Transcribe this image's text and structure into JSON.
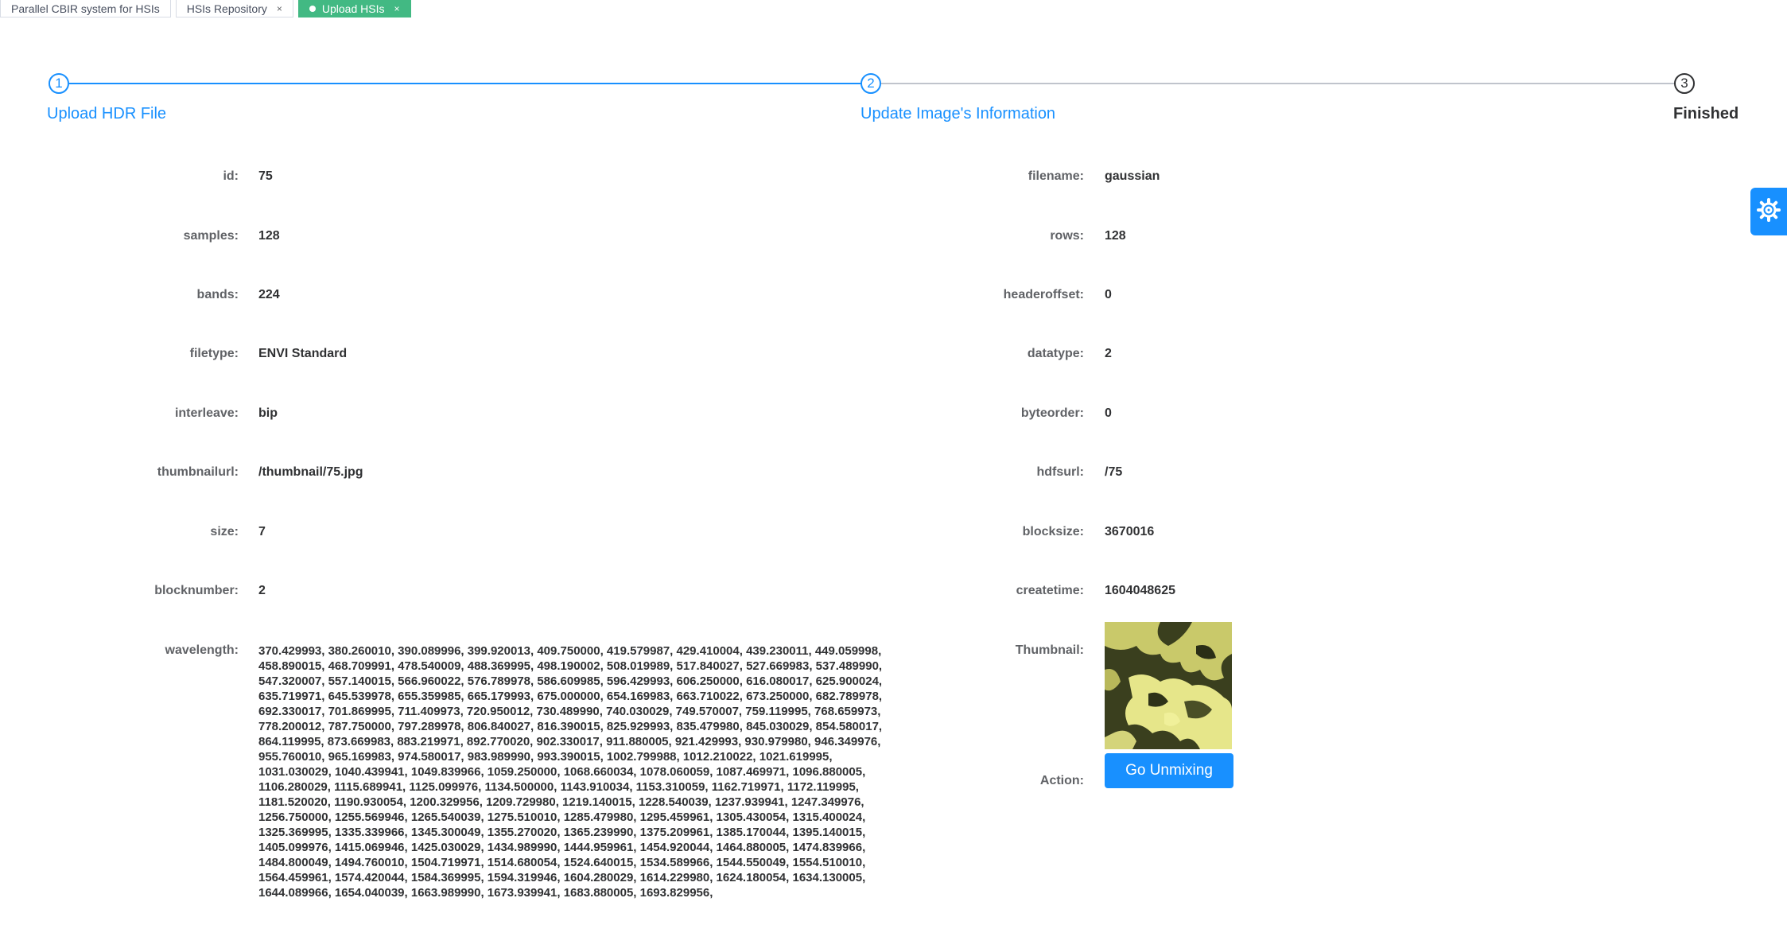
{
  "tabs": [
    {
      "label": "Parallel CBIR system for HSIs",
      "closable": false,
      "active": false
    },
    {
      "label": "HSIs Repository",
      "closable": true,
      "active": false
    },
    {
      "label": "Upload HSIs",
      "closable": true,
      "active": true
    }
  ],
  "tab_close_glyph": "×",
  "steps": [
    {
      "number": "1",
      "title": "Upload HDR File"
    },
    {
      "number": "2",
      "title": "Update Image's Information"
    },
    {
      "number": "3",
      "title": "Finished"
    }
  ],
  "fields_left": [
    {
      "label": "id:",
      "value": "75"
    },
    {
      "label": "samples:",
      "value": "128"
    },
    {
      "label": "bands:",
      "value": "224"
    },
    {
      "label": "filetype:",
      "value": "ENVI Standard"
    },
    {
      "label": "interleave:",
      "value": "bip"
    },
    {
      "label": "thumbnailurl:",
      "value": "/thumbnail/75.jpg"
    },
    {
      "label": "size:",
      "value": "7"
    },
    {
      "label": "blocknumber:",
      "value": "2"
    }
  ],
  "fields_right": [
    {
      "label": "filename:",
      "value": "gaussian"
    },
    {
      "label": "rows:",
      "value": "128"
    },
    {
      "label": "headeroffset:",
      "value": "0"
    },
    {
      "label": "datatype:",
      "value": "2"
    },
    {
      "label": "byteorder:",
      "value": "0"
    },
    {
      "label": "hdfsurl:",
      "value": "/75"
    },
    {
      "label": "blocksize:",
      "value": "3670016"
    },
    {
      "label": "createtime:",
      "value": "1604048625"
    }
  ],
  "wavelength": {
    "label": "wavelength:",
    "value": "370.429993, 380.260010, 390.089996, 399.920013, 409.750000, 419.579987, 429.410004, 439.230011, 449.059998, 458.890015, 468.709991, 478.540009, 488.369995, 498.190002, 508.019989, 517.840027, 527.669983, 537.489990, 547.320007, 557.140015, 566.960022, 576.789978, 586.609985, 596.429993, 606.250000, 616.080017, 625.900024, 635.719971, 645.539978, 655.359985, 665.179993, 675.000000, 654.169983, 663.710022, 673.250000, 682.789978, 692.330017, 701.869995, 711.409973, 720.950012, 730.489990, 740.030029, 749.570007, 759.119995, 768.659973, 778.200012, 787.750000, 797.289978, 806.840027, 816.390015, 825.929993, 835.479980, 845.030029, 854.580017, 864.119995, 873.669983, 883.219971, 892.770020, 902.330017, 911.880005, 921.429993, 930.979980, 946.349976, 955.760010, 965.169983, 974.580017, 983.989990, 993.390015, 1002.799988, 1012.210022, 1021.619995, 1031.030029, 1040.439941, 1049.839966, 1059.250000, 1068.660034, 1078.060059, 1087.469971, 1096.880005, 1106.280029, 1115.689941, 1125.099976, 1134.500000, 1143.910034, 1153.310059, 1162.719971, 1172.119995, 1181.520020, 1190.930054, 1200.329956, 1209.729980, 1219.140015, 1228.540039, 1237.939941, 1247.349976, 1256.750000, 1255.569946, 1265.540039, 1275.510010, 1285.479980, 1295.459961, 1305.430054, 1315.400024, 1325.369995, 1335.339966, 1345.300049, 1355.270020, 1365.239990, 1375.209961, 1385.170044, 1395.140015, 1405.099976, 1415.069946, 1425.030029, 1434.989990, 1444.959961, 1454.920044, 1464.880005, 1474.839966, 1484.800049, 1494.760010, 1504.719971, 1514.680054, 1524.640015, 1534.589966, 1544.550049, 1554.510010, 1564.459961, 1574.420044, 1584.369995, 1594.319946, 1604.280029, 1614.229980, 1624.180054, 1634.130005, 1644.089966, 1654.040039, 1663.989990, 1673.939941, 1683.880005, 1693.829956,"
  },
  "thumbnail": {
    "label": "Thumbnail:"
  },
  "action": {
    "label": "Action:",
    "button_label": "Go Unmixing"
  },
  "colors": {
    "accent": "#1890ff",
    "tab_active": "#42b983",
    "text": "#303133",
    "label": "#606266"
  },
  "icons": {
    "settings": "gear-icon"
  }
}
